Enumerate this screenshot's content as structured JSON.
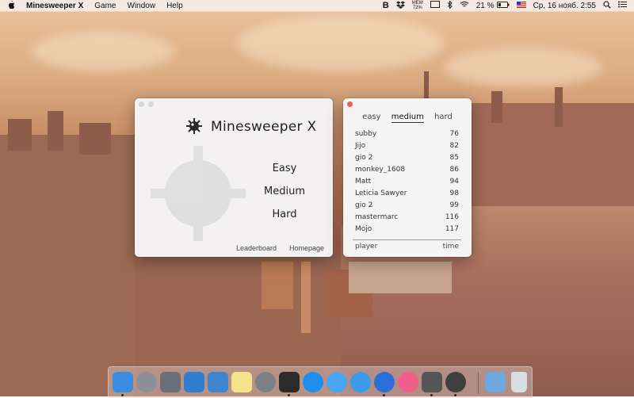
{
  "menubar": {
    "apple": "",
    "app_name": "Minesweeper X",
    "menus": [
      "Game",
      "Window",
      "Help"
    ],
    "mem_label": "MEM",
    "mem_value": "72%",
    "battery": "21 %",
    "datetime": "Ср, 16 нояб.  2:55"
  },
  "main_window": {
    "title": "Minesweeper X",
    "options": [
      "Easy",
      "Medium",
      "Hard"
    ],
    "leaderboard_link": "Leaderboard",
    "homepage_link": "Homepage"
  },
  "leaderboard": {
    "tabs": [
      "easy",
      "medium",
      "hard"
    ],
    "active_tab": "medium",
    "rows": [
      {
        "player": "subby",
        "time": "76"
      },
      {
        "player": "Jijo",
        "time": "82"
      },
      {
        "player": "gio 2",
        "time": "85"
      },
      {
        "player": "monkey_1608",
        "time": "86"
      },
      {
        "player": "Matt",
        "time": "94"
      },
      {
        "player": "Leticia Sawyer",
        "time": "98"
      },
      {
        "player": "gio 2",
        "time": "99"
      },
      {
        "player": "mastermarc",
        "time": "116"
      },
      {
        "player": "Mojo",
        "time": "117"
      }
    ],
    "col_player": "player",
    "col_time": "time"
  },
  "dock": {
    "apps": [
      "finder-icon",
      "launchpad-icon",
      "disk-utility-icon",
      "xcode-icon",
      "preview-icon",
      "notes-icon",
      "system-preferences-icon",
      "terminal-icon",
      "app-store-icon",
      "messages-icon",
      "safari-icon",
      "chat-icon",
      "itunes-icon",
      "sublime-icon",
      "minesweeper-icon",
      "folder-icon",
      "trash-icon"
    ]
  },
  "colors": {
    "close_red": "#ec5f58",
    "inactive_gray": "#cfcfcf",
    "menubar_bg": "#f5eee8"
  }
}
